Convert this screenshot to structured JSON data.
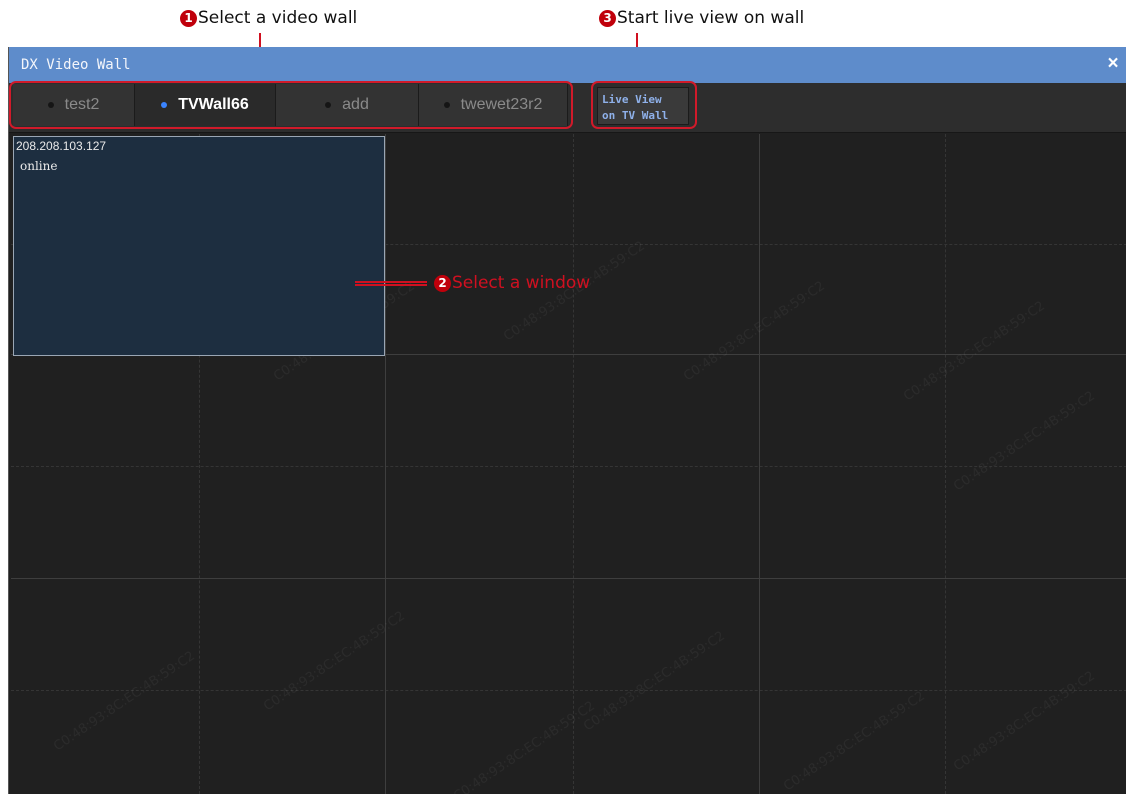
{
  "annotations": {
    "step1": {
      "number": "1",
      "text": "Select a video wall"
    },
    "step2": {
      "number": "2",
      "text": "Select a window"
    },
    "step3": {
      "number": "3",
      "text": "Start live view on wall"
    }
  },
  "window": {
    "title": "DX Video Wall",
    "close_icon": "close-icon",
    "close_glyph": "×"
  },
  "tabs": [
    {
      "label": "test2",
      "active": false
    },
    {
      "label": "TVWall66",
      "active": true
    },
    {
      "label": "add",
      "active": false
    },
    {
      "label": "twewet23r2",
      "active": false
    }
  ],
  "live_view_button": {
    "line1": "Live View",
    "line2": "on TV Wall"
  },
  "selected_window": {
    "ip": "208.208.103.127",
    "status": "online"
  },
  "watermark": "C0:48:93:8C:EC:4B:59:C2",
  "colors": {
    "titlebar": "#5e8ccb",
    "accent_dot": "#3a84ff",
    "annotation_red": "#d01020",
    "selected_cell": "#1d2e40"
  }
}
